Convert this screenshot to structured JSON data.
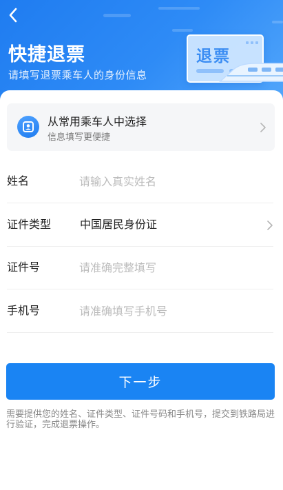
{
  "header": {
    "title": "快捷退票",
    "subtitle": "请填写退票乘车人的身份信息",
    "illustration_text": "退票",
    "back_icon": "chevron-left-icon"
  },
  "picker": {
    "title": "从常用乘车人中选择",
    "subtitle": "信息填写更便捷",
    "icon": "passenger-card-icon"
  },
  "form": {
    "name": {
      "label": "姓名",
      "placeholder": "请输入真实姓名",
      "value": ""
    },
    "id_type": {
      "label": "证件类型",
      "value": "中国居民身份证"
    },
    "id_number": {
      "label": "证件号",
      "placeholder": "请准确完整填写",
      "value": ""
    },
    "phone": {
      "label": "手机号",
      "placeholder": "请准确填写手机号",
      "value": ""
    }
  },
  "actions": {
    "next_label": "下一步"
  },
  "notice": "需要提供您的姓名、证件类型、证件号码和手机号，提交到铁路局进行验证，完成退票操作。",
  "colors": {
    "primary": "#1a84f3",
    "hero_start": "#1f7cf0",
    "hero_end": "#52a6fb"
  }
}
